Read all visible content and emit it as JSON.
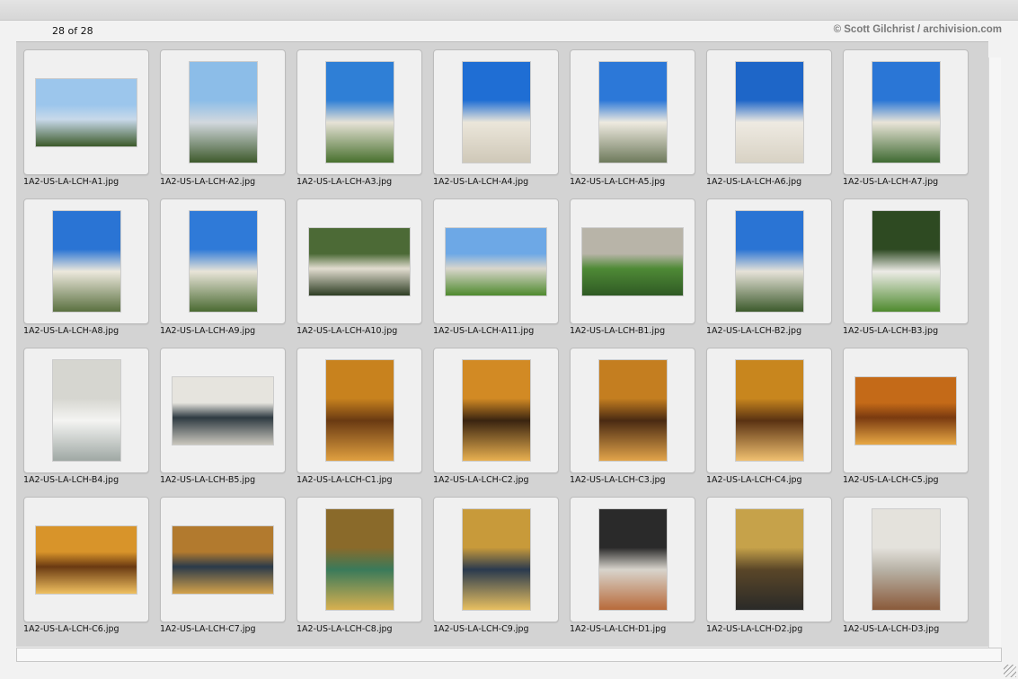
{
  "header": {
    "count": "28 of 28",
    "credit": "© Scott Gilchrist / archivision.com"
  },
  "thumbnails": [
    {
      "filename": "1A2-US-LA-LCH-A1.jpg",
      "orientation": "landscape",
      "colors": [
        "#9cc6ec",
        "#c8d9ea",
        "#3c5a2a"
      ]
    },
    {
      "filename": "1A2-US-LA-LCH-A2.jpg",
      "orientation": "portrait",
      "colors": [
        "#8cbde8",
        "#d2d8de",
        "#3e5a2c"
      ]
    },
    {
      "filename": "1A2-US-LA-LCH-A3.jpg",
      "orientation": "portrait",
      "colors": [
        "#2f7fd6",
        "#e6e2d6",
        "#48702e"
      ]
    },
    {
      "filename": "1A2-US-LA-LCH-A4.jpg",
      "orientation": "portrait",
      "colors": [
        "#1f6ed4",
        "#ebe6da",
        "#cfc8b8"
      ]
    },
    {
      "filename": "1A2-US-LA-LCH-A5.jpg",
      "orientation": "portrait",
      "colors": [
        "#2c78d8",
        "#eeeae0",
        "#6e7a5c"
      ]
    },
    {
      "filename": "1A2-US-LA-LCH-A6.jpg",
      "orientation": "portrait",
      "colors": [
        "#1e66c8",
        "#eeeae2",
        "#d8d2c4"
      ]
    },
    {
      "filename": "1A2-US-LA-LCH-A7.jpg",
      "orientation": "portrait",
      "colors": [
        "#2a76d6",
        "#e9e4d8",
        "#3f6a32"
      ]
    },
    {
      "filename": "1A2-US-LA-LCH-A8.jpg",
      "orientation": "portrait",
      "colors": [
        "#2a74d4",
        "#ece8dc",
        "#5a7040"
      ]
    },
    {
      "filename": "1A2-US-LA-LCH-A9.jpg",
      "orientation": "portrait",
      "colors": [
        "#2f7ad8",
        "#e8e4d8",
        "#4a6a32"
      ]
    },
    {
      "filename": "1A2-US-LA-LCH-A10.jpg",
      "orientation": "landscape",
      "colors": [
        "#4c6a36",
        "#e2ddd0",
        "#2e3e24"
      ]
    },
    {
      "filename": "1A2-US-LA-LCH-A11.jpg",
      "orientation": "landscape",
      "colors": [
        "#6da8e6",
        "#d9d6cc",
        "#4f8a2e"
      ]
    },
    {
      "filename": "1A2-US-LA-LCH-B1.jpg",
      "orientation": "landscape",
      "colors": [
        "#b8b4a8",
        "#4f8a36",
        "#2f5a24"
      ]
    },
    {
      "filename": "1A2-US-LA-LCH-B2.jpg",
      "orientation": "portrait",
      "colors": [
        "#2a74d4",
        "#e6e2d8",
        "#3c5a2c"
      ]
    },
    {
      "filename": "1A2-US-LA-LCH-B3.jpg",
      "orientation": "portrait",
      "colors": [
        "#2e4a22",
        "#ecebe6",
        "#4e8a2e"
      ]
    },
    {
      "filename": "1A2-US-LA-LCH-B4.jpg",
      "orientation": "portrait",
      "colors": [
        "#d6d6d0",
        "#f4f4f2",
        "#9fa8a4"
      ]
    },
    {
      "filename": "1A2-US-LA-LCH-B5.jpg",
      "orientation": "landscape",
      "colors": [
        "#e6e4de",
        "#2e3a42",
        "#c9c6bc"
      ]
    },
    {
      "filename": "1A2-US-LA-LCH-C1.jpg",
      "orientation": "portrait",
      "colors": [
        "#c8821e",
        "#6a3a12",
        "#e0a040"
      ]
    },
    {
      "filename": "1A2-US-LA-LCH-C2.jpg",
      "orientation": "portrait",
      "colors": [
        "#d28a24",
        "#3a2410",
        "#e8b050"
      ]
    },
    {
      "filename": "1A2-US-LA-LCH-C3.jpg",
      "orientation": "portrait",
      "colors": [
        "#c47e20",
        "#4a2a12",
        "#e2a44a"
      ]
    },
    {
      "filename": "1A2-US-LA-LCH-C4.jpg",
      "orientation": "portrait",
      "colors": [
        "#c8861e",
        "#5a3212",
        "#f0c070"
      ]
    },
    {
      "filename": "1A2-US-LA-LCH-C5.jpg",
      "orientation": "landscape",
      "colors": [
        "#c46a18",
        "#7a3a10",
        "#e8a844"
      ]
    },
    {
      "filename": "1A2-US-LA-LCH-C6.jpg",
      "orientation": "landscape",
      "colors": [
        "#d8942a",
        "#6a3a12",
        "#f0c060"
      ]
    },
    {
      "filename": "1A2-US-LA-LCH-C7.jpg",
      "orientation": "landscape",
      "colors": [
        "#b27a2e",
        "#2a3a4a",
        "#d4a24a"
      ]
    },
    {
      "filename": "1A2-US-LA-LCH-C8.jpg",
      "orientation": "portrait",
      "colors": [
        "#8a6a2a",
        "#3a7a5a",
        "#d8b050"
      ]
    },
    {
      "filename": "1A2-US-LA-LCH-C9.jpg",
      "orientation": "portrait",
      "colors": [
        "#c89a3a",
        "#2a3a4e",
        "#e8c060"
      ]
    },
    {
      "filename": "1A2-US-LA-LCH-D1.jpg",
      "orientation": "portrait",
      "colors": [
        "#2a2a2a",
        "#d8d4cc",
        "#b86a3a"
      ]
    },
    {
      "filename": "1A2-US-LA-LCH-D2.jpg",
      "orientation": "portrait",
      "colors": [
        "#c6a24a",
        "#5a4628",
        "#2a2a28"
      ]
    },
    {
      "filename": "1A2-US-LA-LCH-D3.jpg",
      "orientation": "portrait",
      "colors": [
        "#e4e2dc",
        "#b8b2a6",
        "#8a5a3a"
      ]
    }
  ]
}
